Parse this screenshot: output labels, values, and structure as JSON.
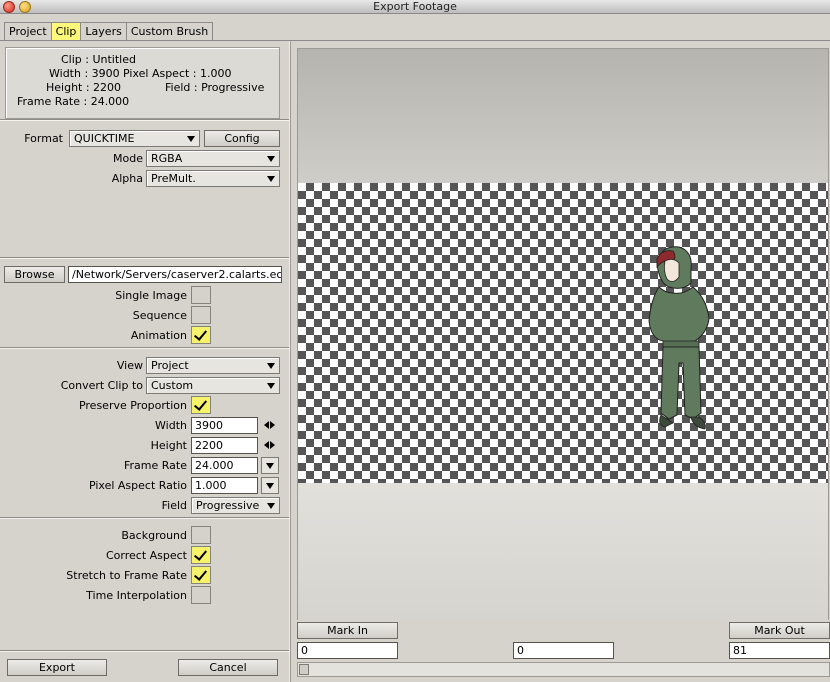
{
  "window": {
    "title": "Export Footage"
  },
  "tabs": [
    {
      "label": "Project"
    },
    {
      "label": "Clip"
    },
    {
      "label": "Layers"
    },
    {
      "label": "Custom Brush"
    }
  ],
  "clip_info": {
    "clip": "Clip : Untitled",
    "width": "Width : 3900",
    "pixel_aspect": "Pixel Aspect : 1.000",
    "height": "Height : 2200",
    "field": "Field : Progressive",
    "frame_rate": "Frame Rate : 24.000"
  },
  "format": {
    "label": "Format",
    "value": "QUICKTIME",
    "config_button": "Config",
    "mode_label": "Mode",
    "mode_value": "RGBA",
    "alpha_label": "Alpha",
    "alpha_value": "PreMult."
  },
  "output": {
    "browse_button": "Browse",
    "path": "/Network/Servers/caserver2.calarts.ec",
    "single_image_label": "Single Image",
    "single_image_checked": false,
    "sequence_label": "Sequence",
    "sequence_checked": false,
    "animation_label": "Animation",
    "animation_checked": true
  },
  "settings": {
    "view_label": "View",
    "view_value": "Project",
    "convert_label": "Convert Clip to",
    "convert_value": "Custom",
    "preserve_label": "Preserve Proportion",
    "preserve_checked": true,
    "width_label": "Width",
    "width_value": "3900",
    "height_label": "Height",
    "height_value": "2200",
    "frame_rate_label": "Frame Rate",
    "frame_rate_value": "24.000",
    "pixel_aspect_label": "Pixel Aspect Ratio",
    "pixel_aspect_value": "1.000",
    "field_label": "Field",
    "field_value": "Progressive"
  },
  "options": {
    "background_label": "Background",
    "background_checked": false,
    "correct_aspect_label": "Correct Aspect",
    "correct_aspect_checked": true,
    "stretch_label": "Stretch to Frame Rate",
    "stretch_checked": true,
    "time_interp_label": "Time Interpolation",
    "time_interp_checked": false
  },
  "footer": {
    "export_button": "Export",
    "cancel_button": "Cancel"
  },
  "timeline": {
    "mark_in_button": "Mark In",
    "mark_out_button": "Mark Out",
    "in_value": "0",
    "current_value": "0",
    "out_value": "81"
  },
  "colors": {
    "active_tab": "#fbf87a",
    "checked_box": "#f6f36a",
    "panel_bg": "#d6d3cc"
  }
}
